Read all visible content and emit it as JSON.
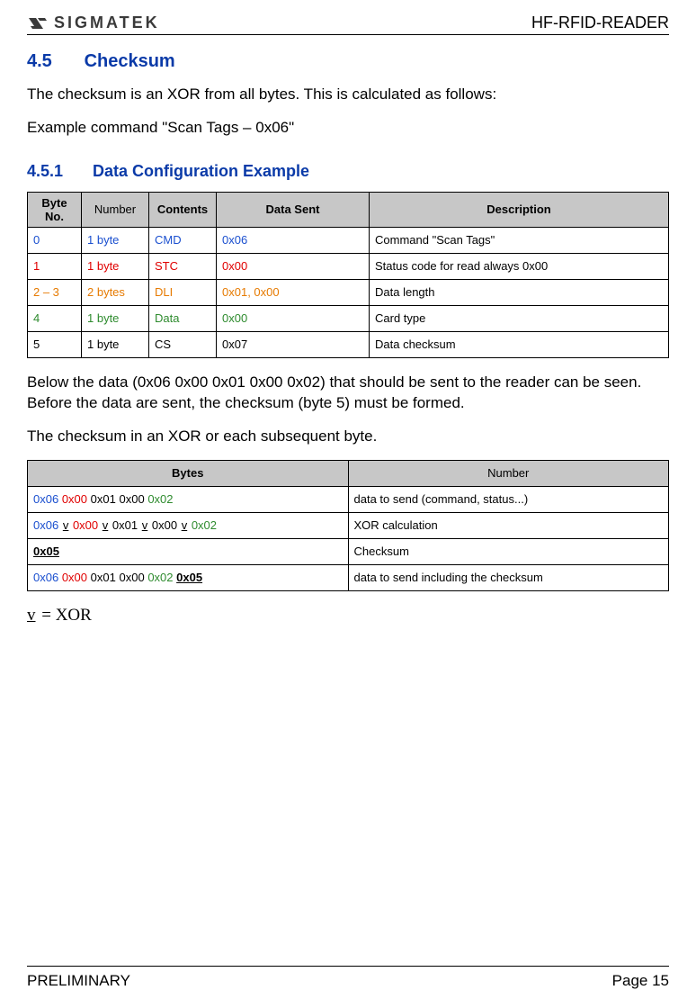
{
  "header": {
    "logo_text": "SIGMATEK",
    "doc_title": "HF-RFID-READER"
  },
  "sections": {
    "h2_num": "4.5",
    "h2_title": "Checksum",
    "p1": "The checksum is an XOR from all bytes. This is calculated as follows:",
    "p2": "Example command \"Scan Tags – 0x06\"",
    "h3_num": "4.5.1",
    "h3_title": "Data Configuration Example",
    "p3": "Below the data (0x06 0x00 0x01 0x00 0x02) that should be sent to the reader can be seen. Before the data are sent, the checksum (byte 5) must be formed.",
    "p4": "The checksum in an XOR or each subsequent byte."
  },
  "table1": {
    "headers": {
      "byte_no": "Byte No.",
      "number": "Number",
      "contents": "Contents",
      "data_sent": "Data Sent",
      "description": "Description"
    },
    "rows": [
      {
        "byte_no": "0",
        "number": "1 byte",
        "contents": "CMD",
        "data_sent": "0x06",
        "description": "Command \"Scan Tags\"",
        "color": "blue"
      },
      {
        "byte_no": "1",
        "number": "1 byte",
        "contents": "STC",
        "data_sent": "0x00",
        "description": "Status code for read always 0x00",
        "color": "red"
      },
      {
        "byte_no": "2 – 3",
        "number": "2 bytes",
        "contents": "DLI",
        "data_sent": "0x01, 0x00",
        "description": "Data length",
        "color": "orange"
      },
      {
        "byte_no": "4",
        "number": "1 byte",
        "contents": "Data",
        "data_sent": "0x00",
        "description": "Card type",
        "color": "green"
      },
      {
        "byte_no": "5",
        "number": "1 byte",
        "contents": "CS",
        "data_sent": "0x07",
        "description": "Data checksum",
        "color": ""
      }
    ]
  },
  "table2": {
    "headers": {
      "bytes": "Bytes",
      "number": "Number"
    },
    "rows": {
      "r1_tokens": [
        {
          "text": "0x06",
          "color": "blue"
        },
        {
          "text": " "
        },
        {
          "text": "0x00",
          "color": "red"
        },
        {
          "text": " "
        },
        {
          "text": "0x01"
        },
        {
          "text": " "
        },
        {
          "text": "0x00"
        },
        {
          "text": " "
        },
        {
          "text": "0x02",
          "color": "green"
        }
      ],
      "r1_desc": "data to send (command, status...)",
      "r2_tokens": [
        {
          "text": "0x06",
          "color": "blue"
        },
        {
          "op": "v"
        },
        {
          "text": "0x00",
          "color": "red"
        },
        {
          "op": "v"
        },
        {
          "text": "0x01"
        },
        {
          "op": "v"
        },
        {
          "text": "0x00"
        },
        {
          "op": "v"
        },
        {
          "text": "0x02",
          "color": "green"
        }
      ],
      "r2_desc": "XOR calculation",
      "r3_bytes": "0x05",
      "r3_desc": "Checksum",
      "r4_tokens": [
        {
          "text": "0x06",
          "color": "blue"
        },
        {
          "text": " "
        },
        {
          "text": "0x00",
          "color": "red"
        },
        {
          "text": " "
        },
        {
          "text": "0x01"
        },
        {
          "text": " "
        },
        {
          "text": "0x00"
        },
        {
          "text": " "
        },
        {
          "text": "0x02",
          "color": "green"
        },
        {
          "text": " "
        },
        {
          "bold_u": "0x05"
        }
      ],
      "r4_desc": "data to send including the checksum"
    }
  },
  "xor_note": {
    "v": "v",
    "eq": " = XOR"
  },
  "footer": {
    "left": "PRELIMINARY",
    "right": "Page 15"
  }
}
